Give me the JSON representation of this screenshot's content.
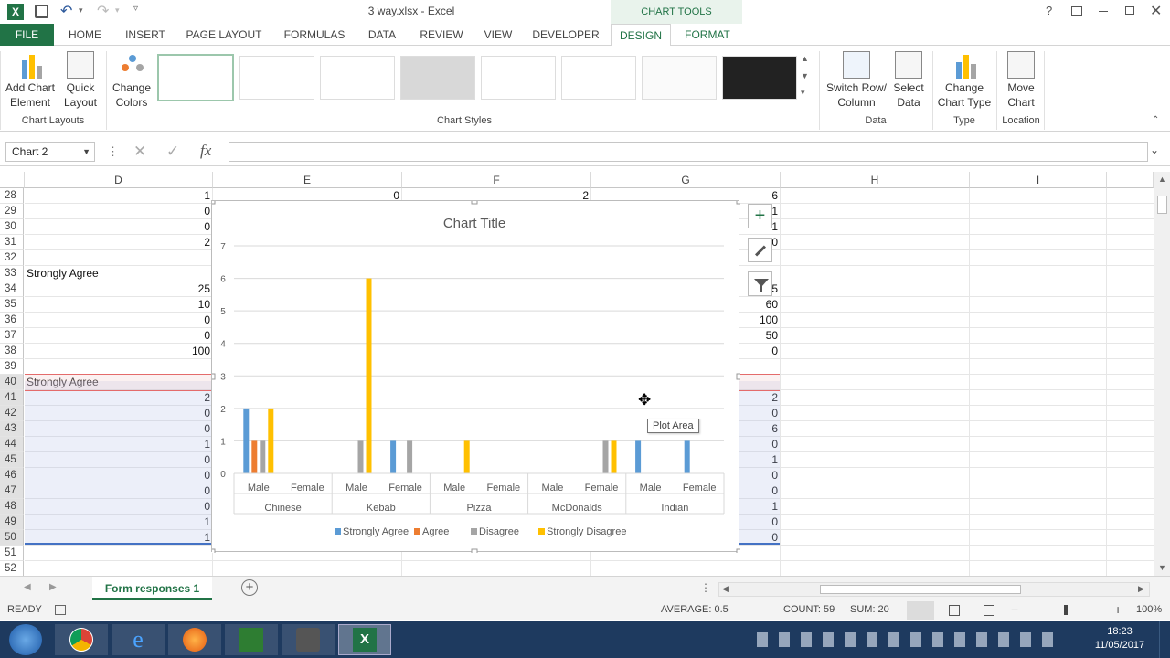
{
  "window": {
    "title": "3 way.xlsx - Excel",
    "context_tab_group": "CHART TOOLS",
    "help_label": "?"
  },
  "tabs": [
    "FILE",
    "HOME",
    "INSERT",
    "PAGE LAYOUT",
    "FORMULAS",
    "DATA",
    "REVIEW",
    "VIEW",
    "DEVELOPER",
    "DESIGN",
    "FORMAT"
  ],
  "ribbon": {
    "add_chart_element": [
      "Add Chart",
      "Element"
    ],
    "quick_layout": [
      "Quick",
      "Layout"
    ],
    "change_colors": [
      "Change",
      "Colors"
    ],
    "switch_row_col": [
      "Switch Row/",
      "Column"
    ],
    "select_data": [
      "Select",
      "Data"
    ],
    "change_chart_type": [
      "Change",
      "Chart Type"
    ],
    "move_chart": [
      "Move",
      "Chart"
    ],
    "groups": {
      "chart_layouts": "Chart Layouts",
      "chart_styles": "Chart Styles",
      "data": "Data",
      "type": "Type",
      "location": "Location"
    }
  },
  "formula_bar": {
    "name_box": "Chart 2",
    "fx": "fx",
    "formula": ""
  },
  "columns": [
    "D",
    "E",
    "F",
    "G",
    "H",
    "I"
  ],
  "rows": [
    "28",
    "29",
    "30",
    "31",
    "32",
    "33",
    "34",
    "35",
    "36",
    "37",
    "38",
    "39",
    "40",
    "41",
    "42",
    "43",
    "44",
    "45",
    "46",
    "47",
    "48",
    "49",
    "50",
    "51",
    "52"
  ],
  "col_d": [
    "1",
    "0",
    "0",
    "2",
    "",
    "Strongly Agree",
    "25",
    "10",
    "0",
    "0",
    "100",
    "",
    "Strongly Agree",
    "2",
    "0",
    "0",
    "1",
    "0",
    "0",
    "0",
    "0",
    "1",
    "1",
    "",
    ""
  ],
  "col_g": [
    "6",
    "1",
    "1",
    "0",
    "",
    "",
    "5",
    "60",
    "100",
    "50",
    "0",
    "",
    "",
    "2",
    "0",
    "6",
    "0",
    "1",
    "0",
    "0",
    "1",
    "0",
    "0",
    "",
    ""
  ],
  "row28": {
    "e": "0",
    "f": "2"
  },
  "tooltip": "Plot Area",
  "chart_buttons": {
    "plus": "+"
  },
  "sheet": {
    "tab": "Form responses 1",
    "add_label": "+"
  },
  "status": {
    "ready": "READY",
    "average": "AVERAGE: 0.5",
    "count": "COUNT: 59",
    "sum": "SUM: 20",
    "zoom": "100%"
  },
  "taskbar": {
    "time": "18:23",
    "date": "11/05/2017"
  },
  "colors": {
    "excel_green": "#217346",
    "strongly_agree": "#5b9bd5",
    "agree": "#ed7d31",
    "disagree": "#a5a5a5",
    "strongly_disagree": "#ffc000"
  },
  "chart_data": {
    "type": "bar",
    "title": "Chart Title",
    "ylim": [
      0,
      7
    ],
    "yticks": [
      "0",
      "1",
      "2",
      "3",
      "4",
      "5",
      "6",
      "7"
    ],
    "grid": true,
    "legend": "bottom",
    "groups": [
      "Chinese",
      "Kebab",
      "Pizza",
      "McDonalds",
      "Indian"
    ],
    "categories": [
      "Male",
      "Female",
      "Male",
      "Female",
      "Male",
      "Female",
      "Male",
      "Female",
      "Male",
      "Female"
    ],
    "series": [
      {
        "name": "Strongly Agree",
        "color": "#5b9bd5",
        "values": [
          2,
          0,
          0,
          1,
          0,
          0,
          0,
          0,
          1,
          1
        ]
      },
      {
        "name": "Agree",
        "color": "#ed7d31",
        "values": [
          1,
          0,
          0,
          0,
          0,
          0,
          0,
          0,
          0,
          0
        ]
      },
      {
        "name": "Disagree",
        "color": "#a5a5a5",
        "values": [
          1,
          0,
          1,
          1,
          0,
          0,
          0,
          1,
          0,
          0
        ]
      },
      {
        "name": "Strongly Disagree",
        "color": "#ffc000",
        "values": [
          2,
          0,
          6,
          0,
          1,
          0,
          0,
          1,
          0,
          0
        ]
      }
    ]
  }
}
